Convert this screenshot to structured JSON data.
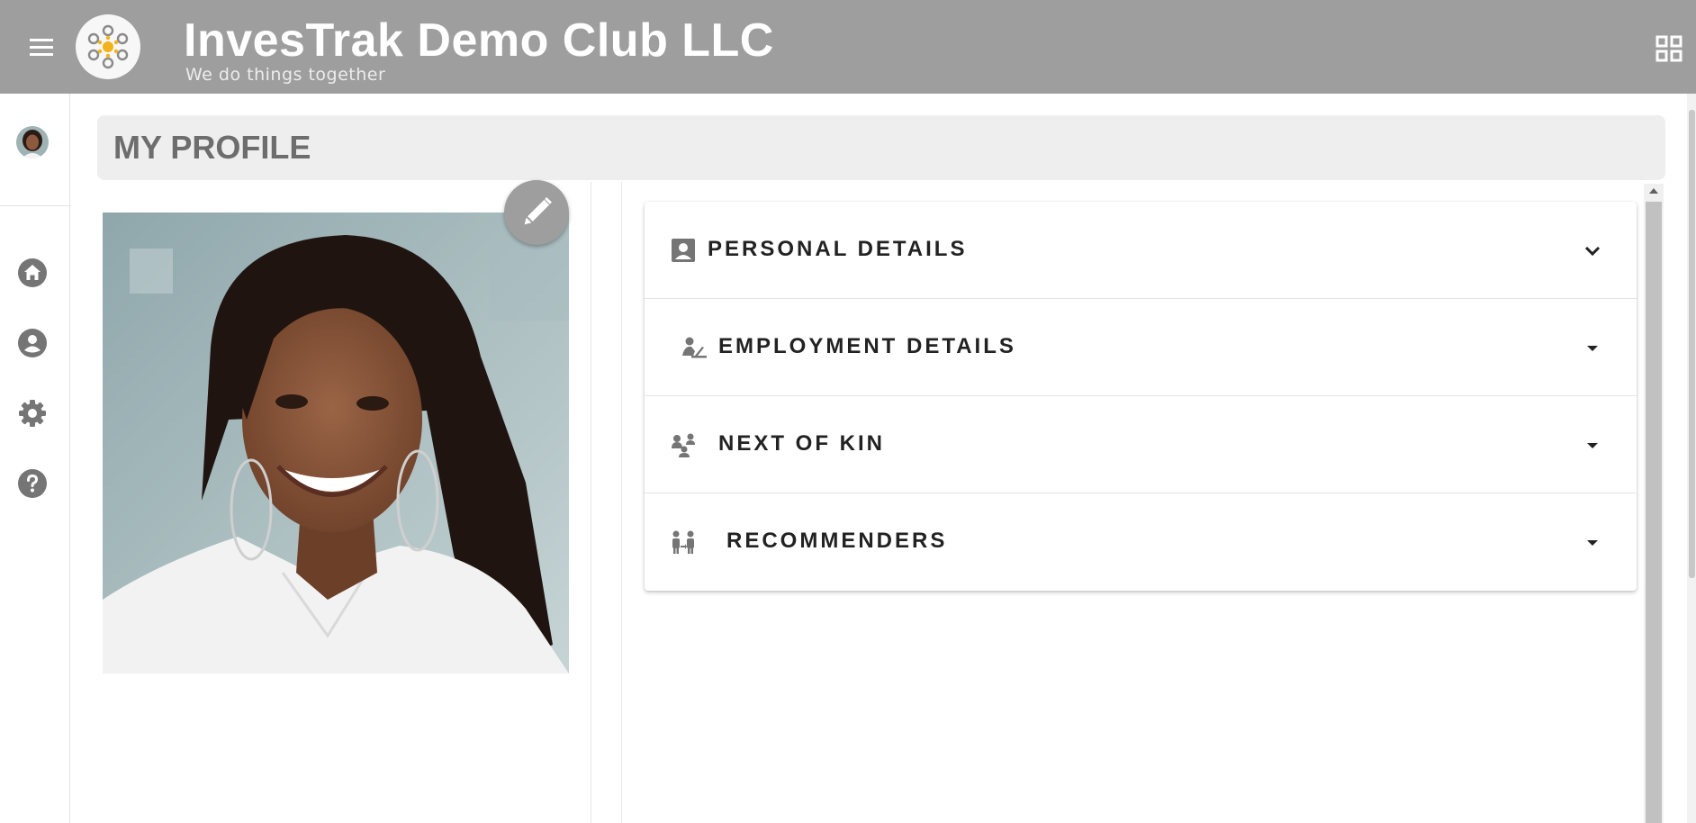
{
  "app": {
    "title": "InvesTrak Demo Club LLC",
    "subtitle": "We do things together"
  },
  "theme": {
    "topbar_bg": "#9e9e9e",
    "header_bg": "#eeeeee",
    "logo_accent": "#f2b21b",
    "icon_gray": "#757575"
  },
  "icons": {
    "menu": "menu-icon",
    "apps": "apps-grid-icon",
    "home": "home-icon",
    "profile": "account-circle-icon",
    "settings": "gear-icon",
    "help": "help-circle-icon",
    "edit": "pencil-icon"
  },
  "page": {
    "title": "MY PROFILE"
  },
  "accordion": {
    "panels": [
      {
        "title": "PERSONAL DETAILS",
        "icon": "contact-card-icon",
        "chevron": "chevron-down-icon"
      },
      {
        "title": "EMPLOYMENT DETAILS",
        "icon": "person-at-desk-icon",
        "chevron": "caret-down-icon"
      },
      {
        "title": "NEXT OF KIN",
        "icon": "family-icon",
        "chevron": "caret-down-icon"
      },
      {
        "title": "RECOMMENDERS",
        "icon": "people-referral-icon",
        "chevron": "caret-down-icon"
      }
    ]
  }
}
